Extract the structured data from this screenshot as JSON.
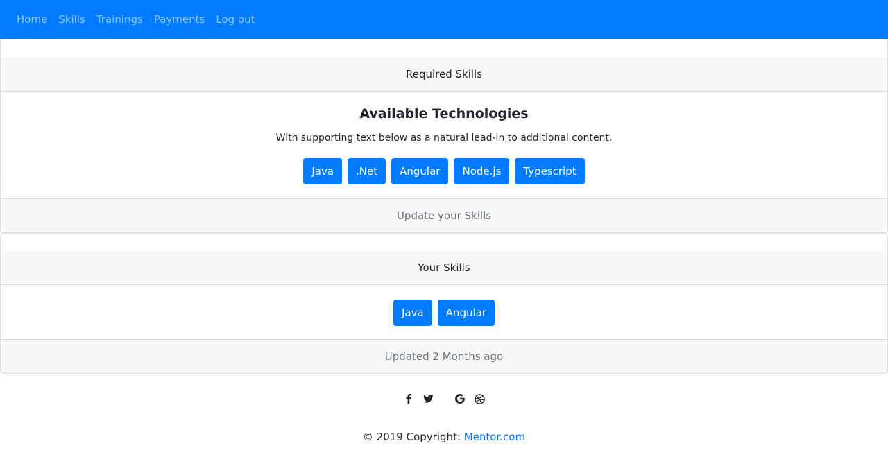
{
  "nav": {
    "links": [
      "Home",
      "Skills",
      "Trainings",
      "Payments",
      "Log out"
    ],
    "background": "#007bff"
  },
  "required": {
    "header": "Required Skills",
    "title": "Available Technologies",
    "text": "With supporting text below as a natural lead-in to additional content.",
    "buttons": [
      "Java",
      ".Net",
      "Angular",
      "Node.js",
      "Typescript"
    ],
    "footer": "Update your Skills"
  },
  "yours": {
    "header": "Your Skills",
    "buttons": [
      "Java",
      "Angular"
    ],
    "footer": "Updated 2 Months ago"
  },
  "social": {
    "icons": [
      "facebook-icon",
      "twitter-icon",
      "google-icon",
      "dribbble-icon"
    ]
  },
  "footer": {
    "copyright": "© 2019 Copyright:",
    "link": "Mentor.com"
  },
  "colors": {
    "accent": "#007bff",
    "muted": "#6c757d",
    "header_bg": "#f7f7f7"
  }
}
